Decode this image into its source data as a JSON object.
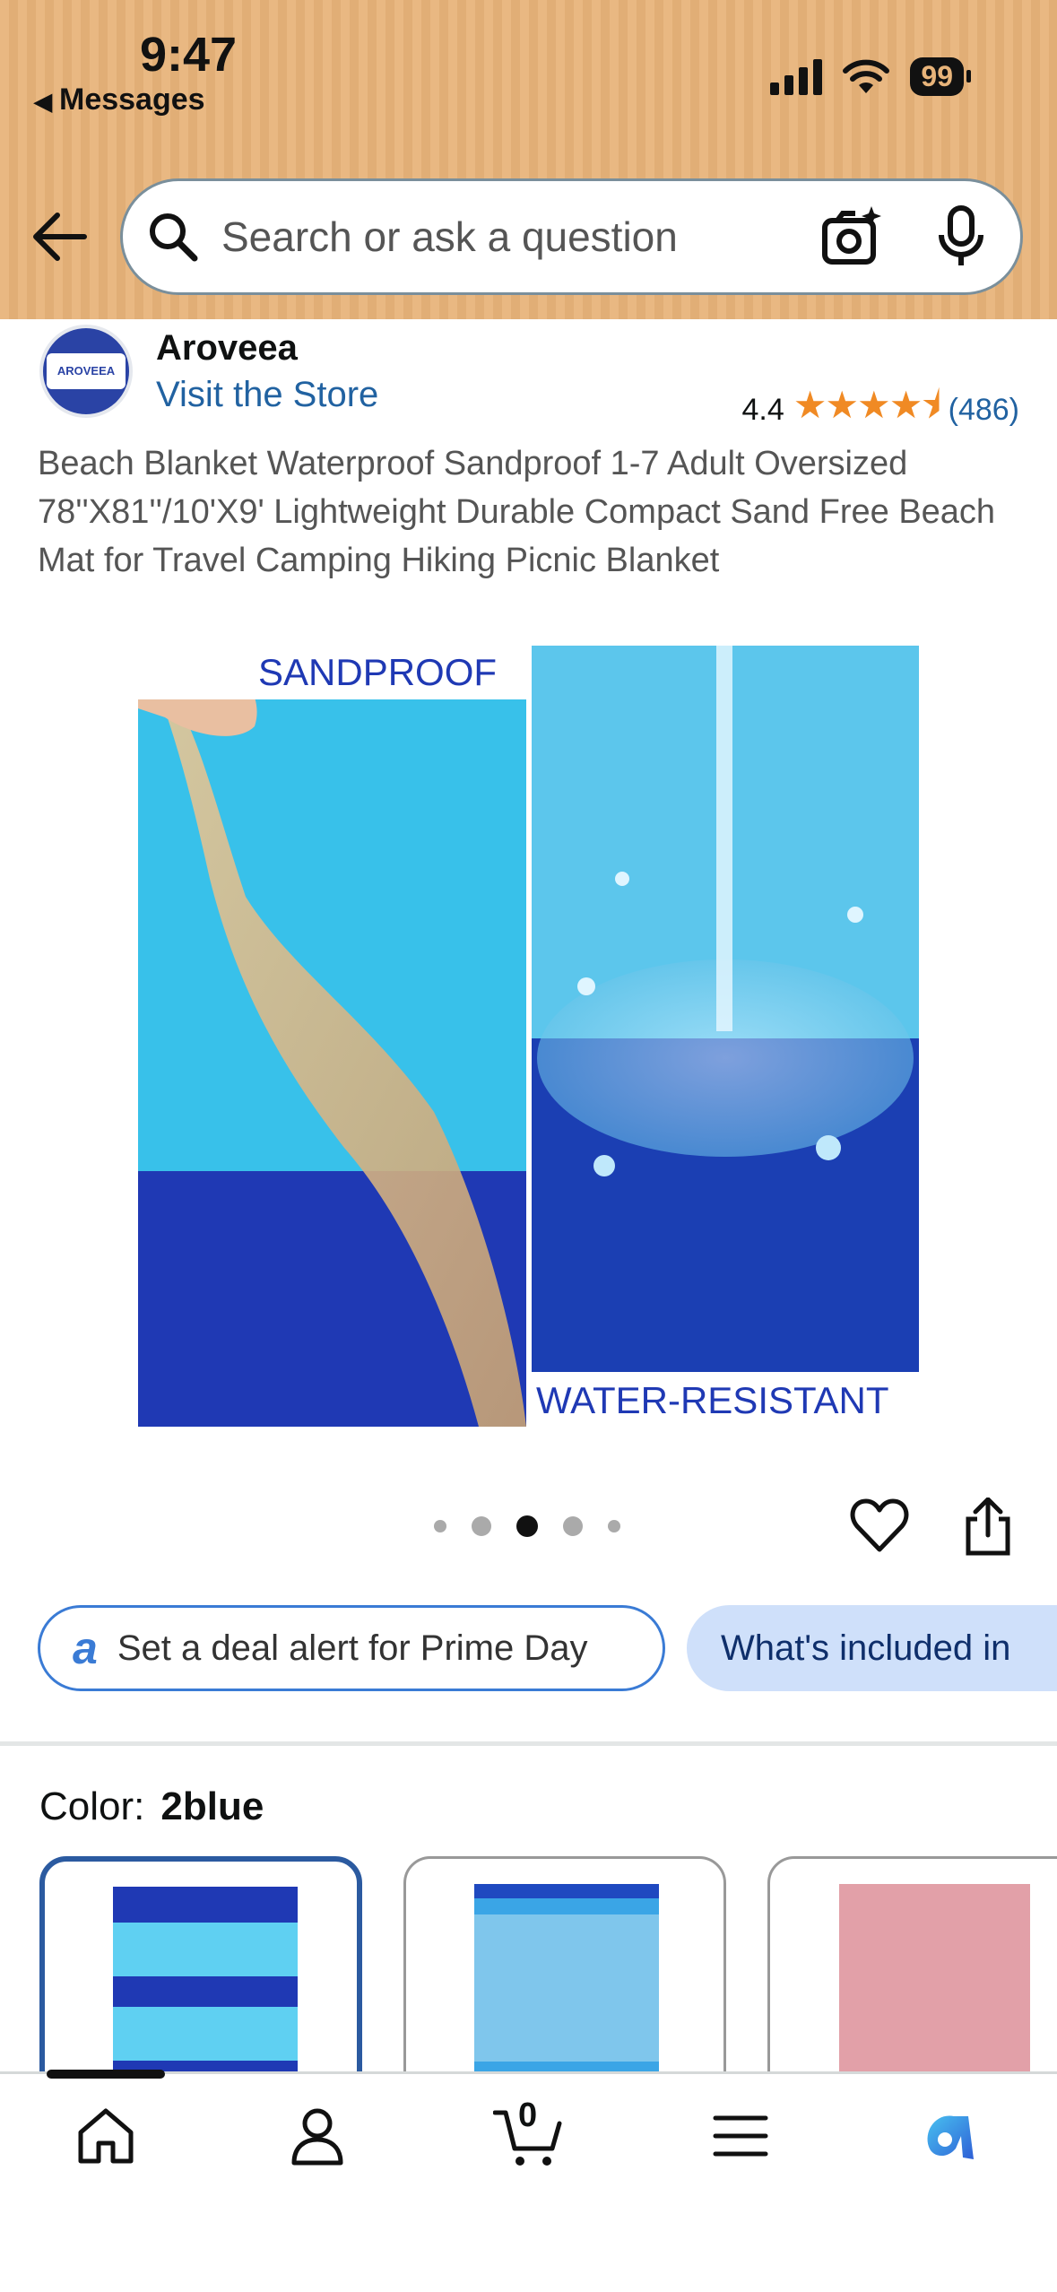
{
  "status": {
    "time": "9:47",
    "back_app": "Messages",
    "battery": "99"
  },
  "search": {
    "placeholder": "Search or ask a question",
    "icons": [
      "search-icon",
      "camera-icon",
      "microphone-icon"
    ]
  },
  "brand": {
    "name": "Aroveea",
    "visit_store": "Visit the Store",
    "logo_text": "AROVEEA"
  },
  "rating": {
    "value": "4.4",
    "stars": 4.4,
    "count": "(486)"
  },
  "product": {
    "title": "Beach Blanket Waterproof Sandproof 1-7 Adult Oversized 78''X81''/10'X9' Lightweight Durable Compact Sand Free Beach Mat for Travel Camping Hiking Picnic Blanket",
    "image_labels": {
      "left": "SANDPROOF",
      "right": "WATER-RESISTANT"
    },
    "image_carousel": {
      "count": 5,
      "active_index": 2
    }
  },
  "chips": {
    "deal_alert": "Set a deal alert for Prime Day",
    "whats_included": "What's included in"
  },
  "color": {
    "label": "Color:",
    "value": "2blue",
    "swatches": [
      "2blue",
      "light blue",
      "pink"
    ]
  },
  "bottom_nav": {
    "items": [
      "home-icon",
      "account-icon",
      "cart-icon",
      "menu-icon",
      "rufus-icon"
    ],
    "cart_count": "0"
  },
  "colors": {
    "header_bg": "#e8b47a",
    "link": "#2162a1",
    "star": "#f08a24",
    "selected_border": "#2b5aa0"
  }
}
